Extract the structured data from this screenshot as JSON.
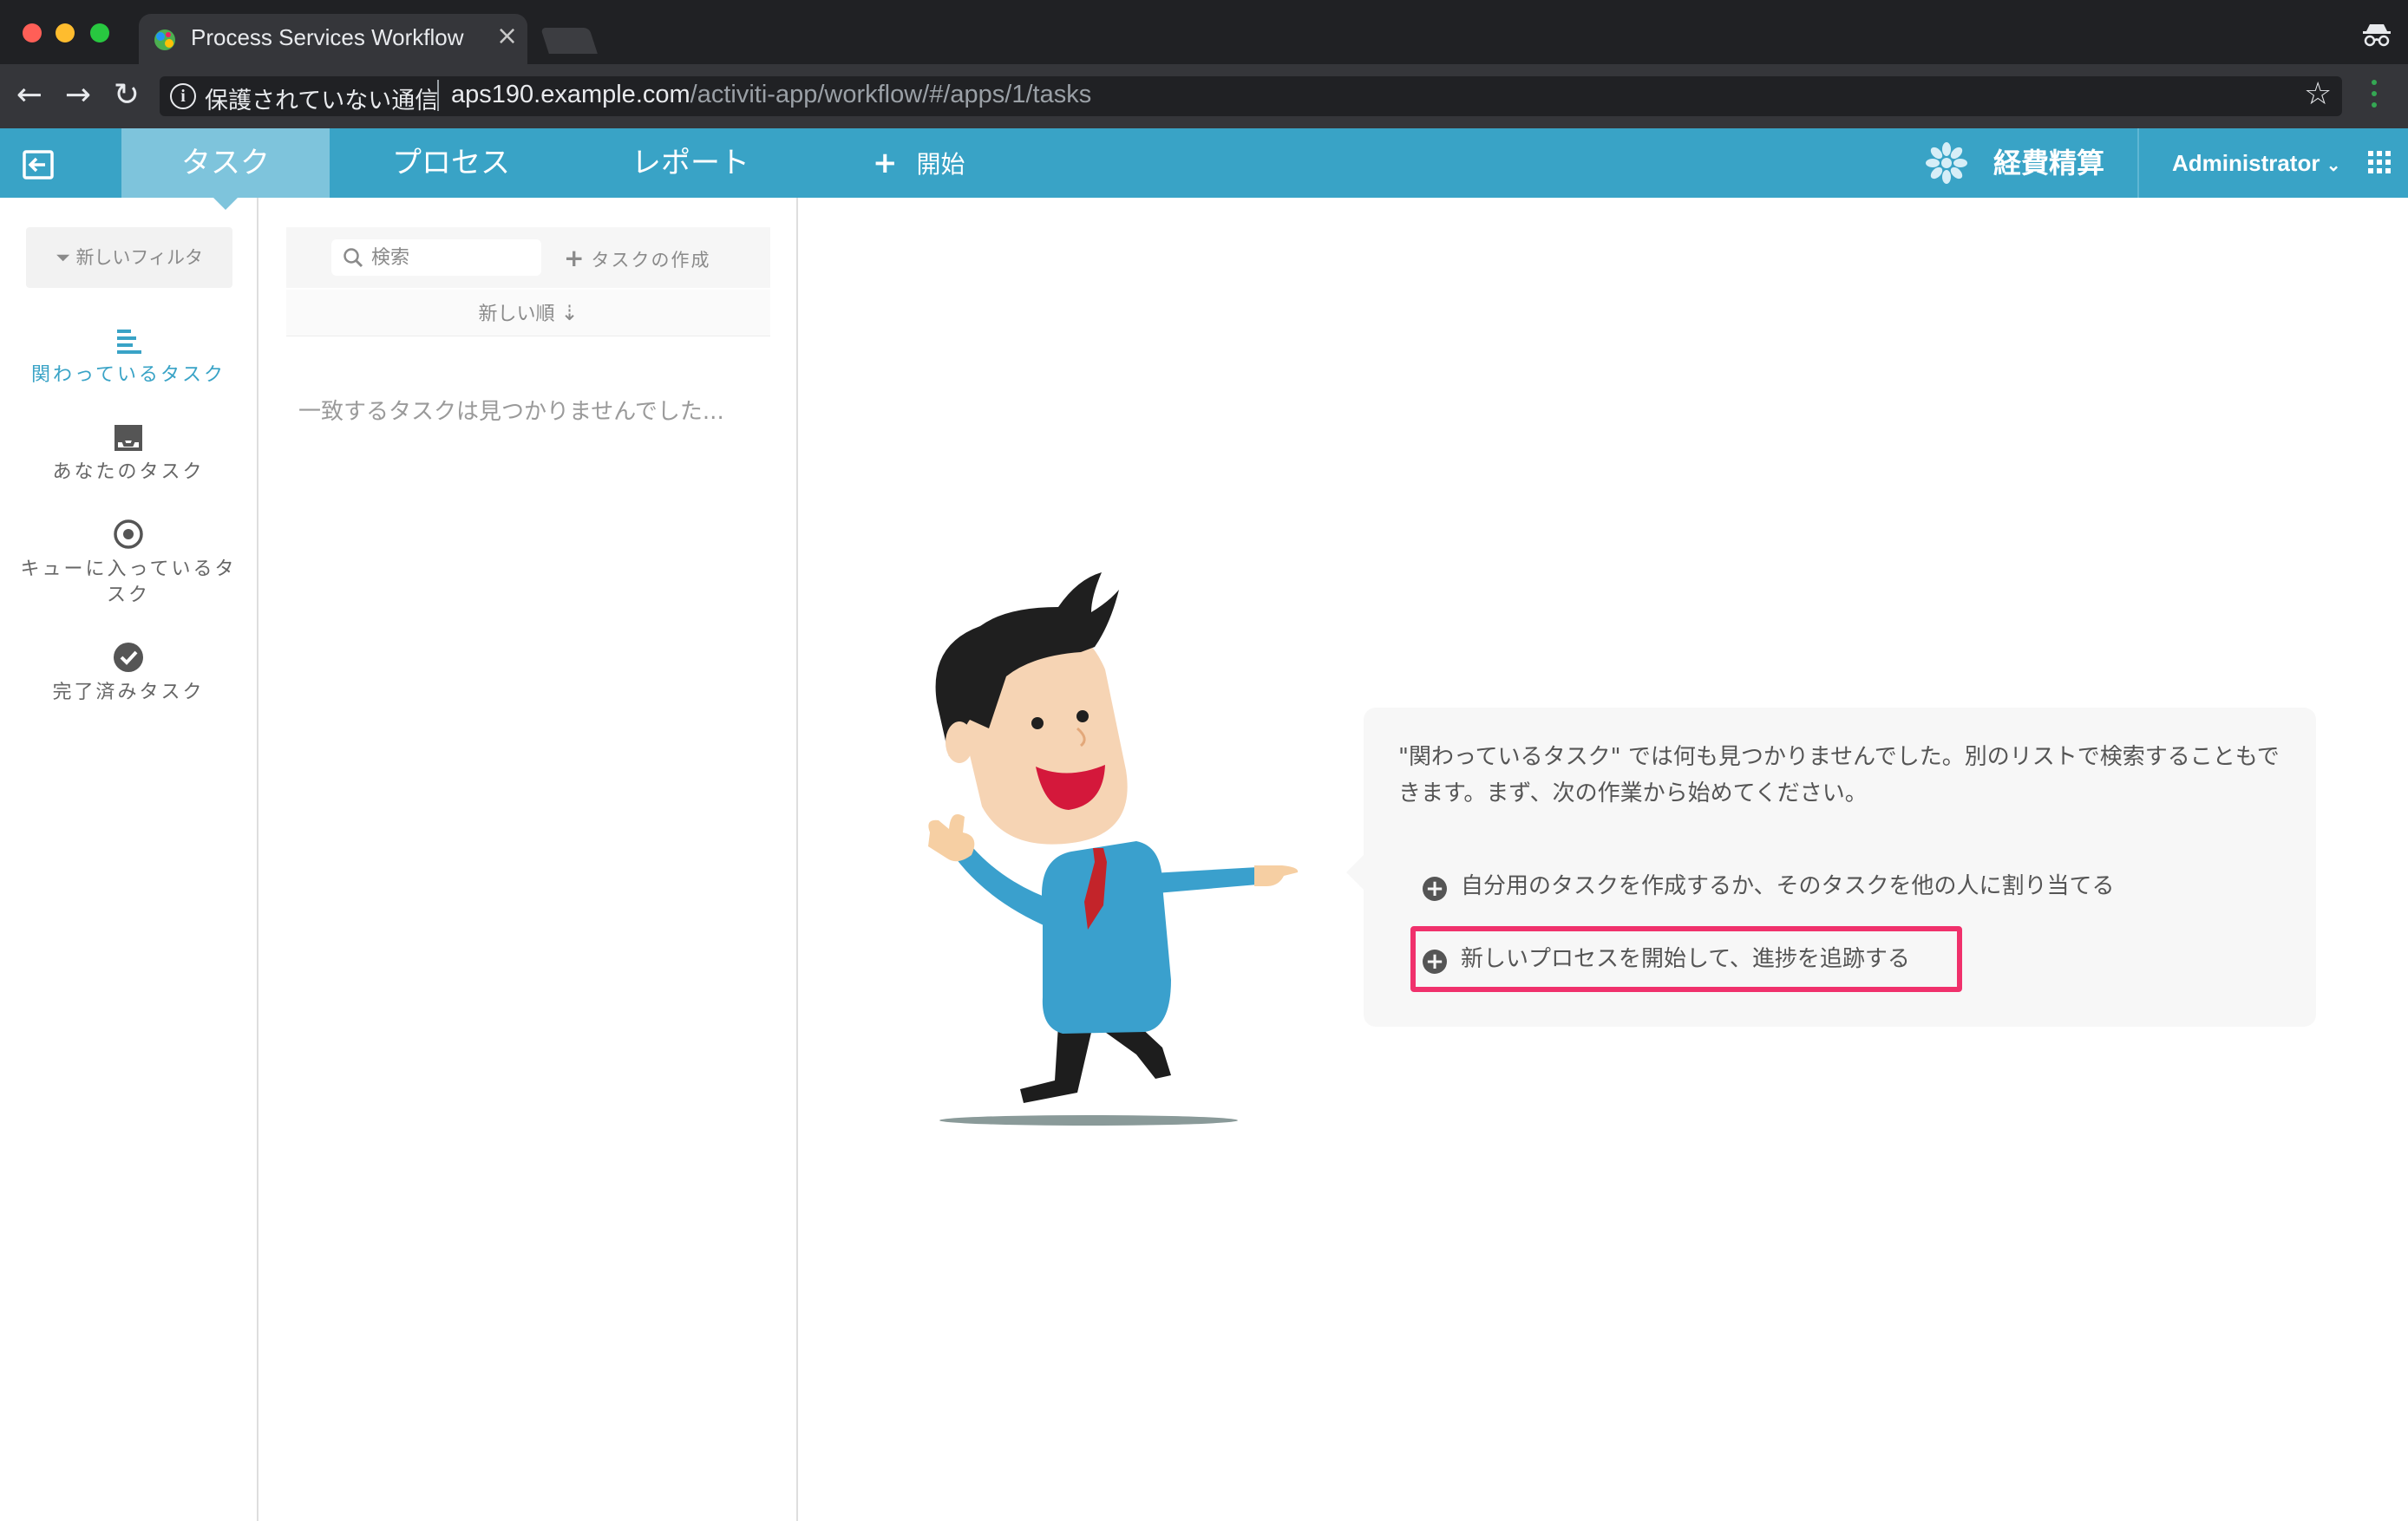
{
  "browser": {
    "tab_title": "Process Services Workflow",
    "tab_close": "×",
    "url_insecure_label": "保護されていない通信",
    "url_host": "aps190.example.com",
    "url_path": "/activiti-app/workflow/#/apps/1/tasks"
  },
  "header": {
    "tabs": [
      {
        "label": "タスク",
        "active": true
      },
      {
        "label": "プロセス",
        "active": false
      },
      {
        "label": "レポート",
        "active": false
      }
    ],
    "start_label": "開始",
    "app_name": "経費精算",
    "user_name": "Administrator",
    "accent_color": "#39a3c6"
  },
  "filters": {
    "new_filter_label": "新しいフィルタ",
    "items": [
      {
        "label": "関わっているタスク",
        "icon": "list-icon",
        "active": true
      },
      {
        "label": "あなたのタスク",
        "icon": "inbox-icon",
        "active": false
      },
      {
        "label": "キューに入っているタスク",
        "icon": "target-icon",
        "active": false
      },
      {
        "label": "完了済みタスク",
        "icon": "check-circle-icon",
        "active": false
      }
    ]
  },
  "task_list": {
    "search_placeholder": "検索",
    "create_task_label": "タスクの作成",
    "sort_label": "新しい順",
    "empty_message": "一致するタスクは見つかりませんでした..."
  },
  "help": {
    "message": "\"関わっているタスク\" では何も見つかりませんでした。別のリストで検索することもできます。まず、次の作業から始めてください。",
    "actions": [
      {
        "label": "自分用のタスクを作成するか、そのタスクを他の人に割り当てる"
      },
      {
        "label": "新しいプロセスを開始して、進捗を追跡する",
        "highlighted": true
      }
    ],
    "highlight_color": "#f0316c"
  }
}
